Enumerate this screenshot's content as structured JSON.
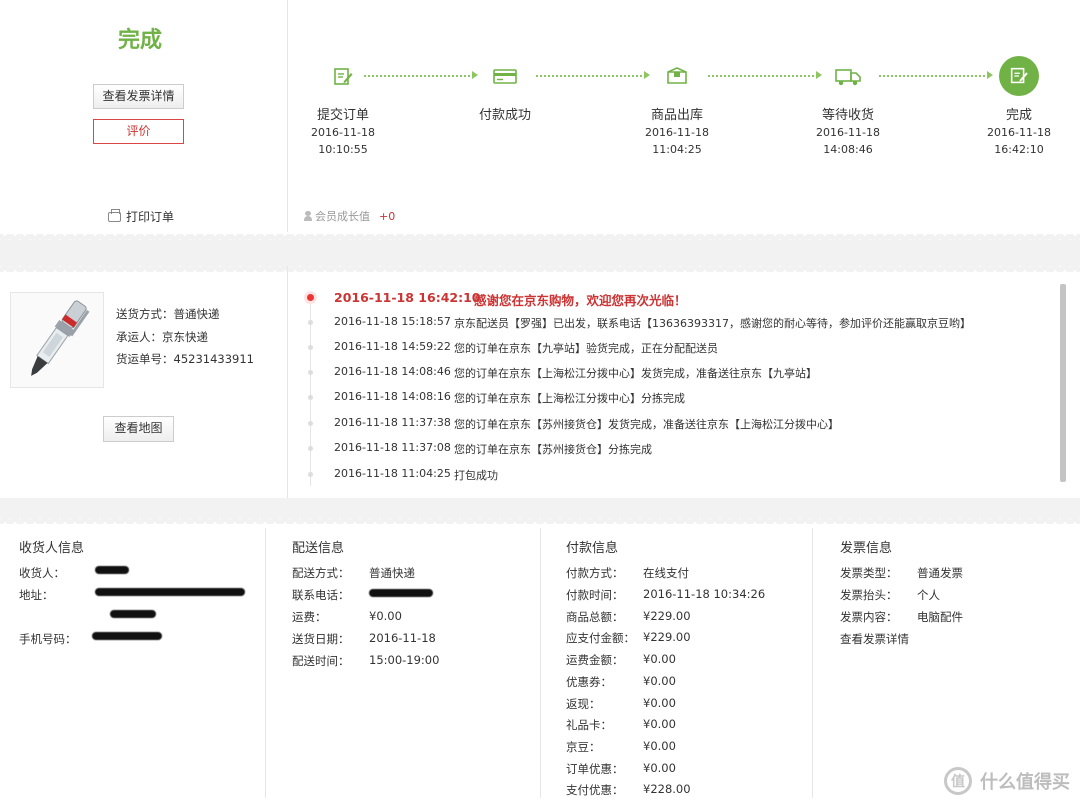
{
  "status": {
    "title": "完成",
    "invoice_button": "查看发票详情",
    "review_button": "评价",
    "print_label": "打印订单"
  },
  "steps": [
    {
      "name": "提交订单",
      "date": "2016-11-18",
      "time": "10:10:55",
      "icon": "edit-icon"
    },
    {
      "name": "付款成功",
      "date": "",
      "time": "",
      "icon": "card-icon"
    },
    {
      "name": "商品出库",
      "date": "2016-11-18",
      "time": "11:04:25",
      "icon": "box-icon"
    },
    {
      "name": "等待收货",
      "date": "2016-11-18",
      "time": "14:08:46",
      "icon": "truck-icon"
    },
    {
      "name": "完成",
      "date": "2016-11-18",
      "time": "16:42:10",
      "icon": "check-icon"
    }
  ],
  "member": {
    "label": "会员成长值",
    "value": "+0"
  },
  "shipment": {
    "method_label": "送货方式：",
    "method": "普通快递",
    "carrier_label": "承运人：",
    "carrier": "京东快递",
    "tracking_label": "货运单号：",
    "tracking": "45231433911",
    "map_button": "查看地图"
  },
  "logistics": [
    {
      "time": "2016-11-18 16:42:10",
      "msg": "感谢您在京东购物，欢迎您再次光临！"
    },
    {
      "time": "2016-11-18 15:18:57",
      "msg": "京东配送员【罗强】已出发，联系电话【13636393317，感谢您的耐心等待，参加评价还能赢取京豆哟】"
    },
    {
      "time": "2016-11-18 14:59:22",
      "msg": "您的订单在京东【九亭站】验货完成，正在分配配送员"
    },
    {
      "time": "2016-11-18 14:08:46",
      "msg": "您的订单在京东【上海松江分拨中心】发货完成，准备送往京东【九亭站】"
    },
    {
      "time": "2016-11-18 14:08:16",
      "msg": "您的订单在京东【上海松江分拨中心】分拣完成"
    },
    {
      "time": "2016-11-18 11:37:38",
      "msg": "您的订单在京东【苏州接货仓】发货完成，准备送往京东【上海松江分拨中心】"
    },
    {
      "time": "2016-11-18 11:37:08",
      "msg": "您的订单在京东【苏州接货仓】分拣完成"
    },
    {
      "time": "2016-11-18 11:04:25",
      "msg": "打包成功"
    }
  ],
  "receiver": {
    "title": "收货人信息",
    "name_label": "收货人：",
    "address_label": "地址：",
    "phone_label": "手机号码："
  },
  "delivery": {
    "title": "配送信息",
    "rows": [
      {
        "label": "配送方式：",
        "value": "普通快递"
      },
      {
        "label": "联系电话：",
        "value": ""
      },
      {
        "label": "运费：",
        "value": "¥0.00"
      },
      {
        "label": "送货日期：",
        "value": "2016-11-18"
      },
      {
        "label": "配送时间：",
        "value": "15:00-19:00"
      }
    ]
  },
  "payment": {
    "title": "付款信息",
    "rows": [
      {
        "label": "付款方式：",
        "value": "在线支付"
      },
      {
        "label": "付款时间：",
        "value": "2016-11-18 10:34:26"
      },
      {
        "label": "商品总额：",
        "value": "¥229.00"
      },
      {
        "label": "应支付金额：",
        "value": "¥229.00"
      },
      {
        "label": "运费金额：",
        "value": "¥0.00"
      },
      {
        "label": "优惠券：",
        "value": "¥0.00"
      },
      {
        "label": "返现：",
        "value": "¥0.00"
      },
      {
        "label": "礼品卡：",
        "value": "¥0.00"
      },
      {
        "label": "京豆：",
        "value": "¥0.00"
      },
      {
        "label": "订单优惠：",
        "value": "¥0.00"
      },
      {
        "label": "支付优惠：",
        "value": "¥228.00"
      }
    ]
  },
  "invoice": {
    "title": "发票信息",
    "rows": [
      {
        "label": "发票类型：",
        "value": "普通发票"
      },
      {
        "label": "发票抬头：",
        "value": "个人"
      },
      {
        "label": "发票内容：",
        "value": "电脑配件"
      }
    ],
    "detail_link": "查看发票详情"
  },
  "watermark": {
    "text": "什么值得买",
    "icon_glyph": "值"
  },
  "colors": {
    "accent_green": "#71b247",
    "accent_red": "#cc3333"
  }
}
